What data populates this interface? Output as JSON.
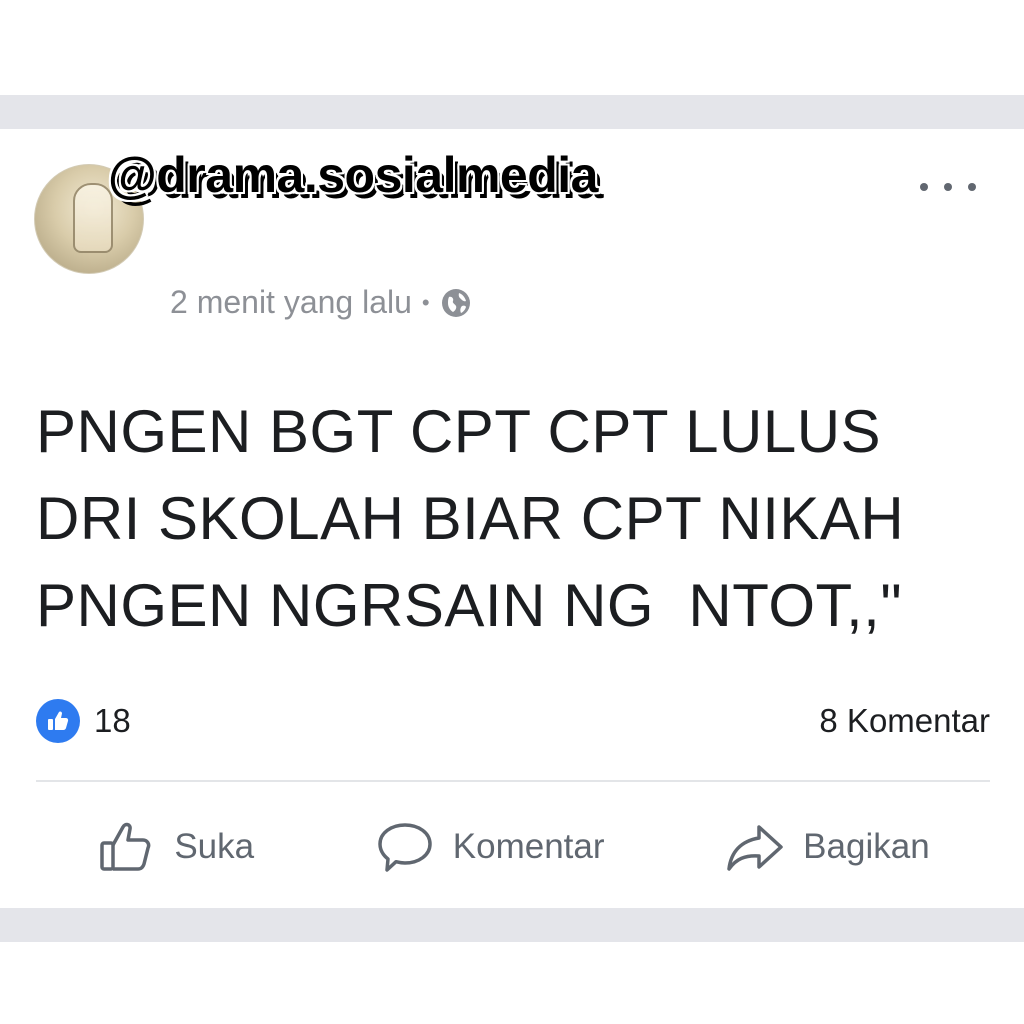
{
  "post": {
    "watermark": "@drama.sosialmedia",
    "timestamp": "2 menit yang lalu",
    "separator": "•",
    "privacy_icon": "globe-icon",
    "text_lines": [
      "PNGEN BGT CPT CPT LULUS",
      "DRI SKOLAH BIAR CPT NIKAH",
      "PNGEN NGRSAIN NG  NTOT,,\""
    ]
  },
  "stats": {
    "like_count": "18",
    "comment_count": "8 Komentar"
  },
  "actions": {
    "like_label": "Suka",
    "comment_label": "Komentar",
    "share_label": "Bagikan"
  },
  "colors": {
    "like_badge": "#2e7bf0",
    "background_band": "#e4e5ea",
    "muted_text": "#8d9096"
  }
}
